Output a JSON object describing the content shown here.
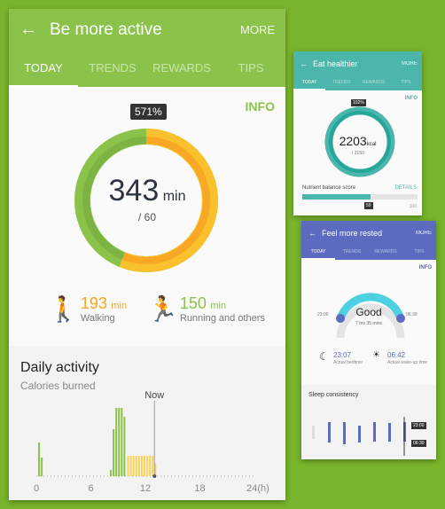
{
  "colors": {
    "background": "#79b52c",
    "active": "#8bc34a",
    "walking": "#f6a623",
    "eat": "#4db6ac",
    "rest": "#5c6bc0"
  },
  "main": {
    "title": "Be more active",
    "more": "MORE",
    "tabs": [
      {
        "label": "TODAY"
      },
      {
        "label": "TRENDS"
      },
      {
        "label": "REWARDS"
      },
      {
        "label": "TIPS"
      }
    ],
    "info": "INFO",
    "percent": "571%",
    "total": "343",
    "total_unit": "min",
    "goal": "/ 60",
    "walking": {
      "value": "193",
      "unit": "min",
      "label": "Walking",
      "icon": "walking-icon"
    },
    "running": {
      "value": "150",
      "unit": "min",
      "label": "Running and others",
      "icon": "running-icon"
    },
    "daily": {
      "title": "Daily activity",
      "subtitle": "Calories burned",
      "now_label": "Now",
      "now_hour": 13,
      "x_ticks": [
        "0",
        "6",
        "12",
        "18",
        "24(h)"
      ],
      "chart_data": {
        "type": "bar",
        "x_unit": "h",
        "xlim": [
          0,
          24
        ],
        "series": [
          {
            "color": "#8bc34a",
            "x": [
              0.2,
              0.5,
              8.1,
              8.4,
              8.7,
              9.0,
              9.3,
              9.6
            ],
            "values": [
              38,
              21,
              7,
              53,
              77,
              77,
              77,
              67
            ]
          },
          {
            "color": "#fcd35a",
            "x": [
              10,
              10.3,
              10.6,
              10.9,
              11.2,
              11.5,
              11.8,
              12.1,
              12.4,
              12.7,
              13.0
            ],
            "values": [
              23,
              23,
              23,
              23,
              23,
              23,
              23,
              23,
              23,
              23,
              14
            ]
          }
        ]
      }
    }
  },
  "eat": {
    "title": "Eat healthier",
    "more": "MORE",
    "tabs": [
      {
        "label": "TODAY"
      },
      {
        "label": "TRENDS"
      },
      {
        "label": "REWARDS"
      },
      {
        "label": "TIPS"
      }
    ],
    "info": "INFO",
    "percent": "102%",
    "value": "2203",
    "unit": "kcal",
    "goal": "/ 2150",
    "score_label": "Nutrient balance score",
    "details": "DETAILS",
    "score": "59",
    "score_max": "100",
    "score_fraction": 0.59
  },
  "rest": {
    "title": "Feel more rested",
    "more": "MORE",
    "tabs": [
      {
        "label": "TODAY"
      },
      {
        "label": "TRENDS"
      },
      {
        "label": "REWARDS"
      },
      {
        "label": "TIPS"
      }
    ],
    "info": "INFO",
    "quality": "Good",
    "duration": "7 hrs 35 mins",
    "start": "23:00",
    "end": "06:30",
    "bedtime": "23:07",
    "bedtime_label": "Actual bedtime",
    "wake": "06:42",
    "wake_label": "Actual wake-up time",
    "consistency": "Sleep consistency",
    "tag_top": "23:00",
    "tag_bottom": "06:30"
  }
}
